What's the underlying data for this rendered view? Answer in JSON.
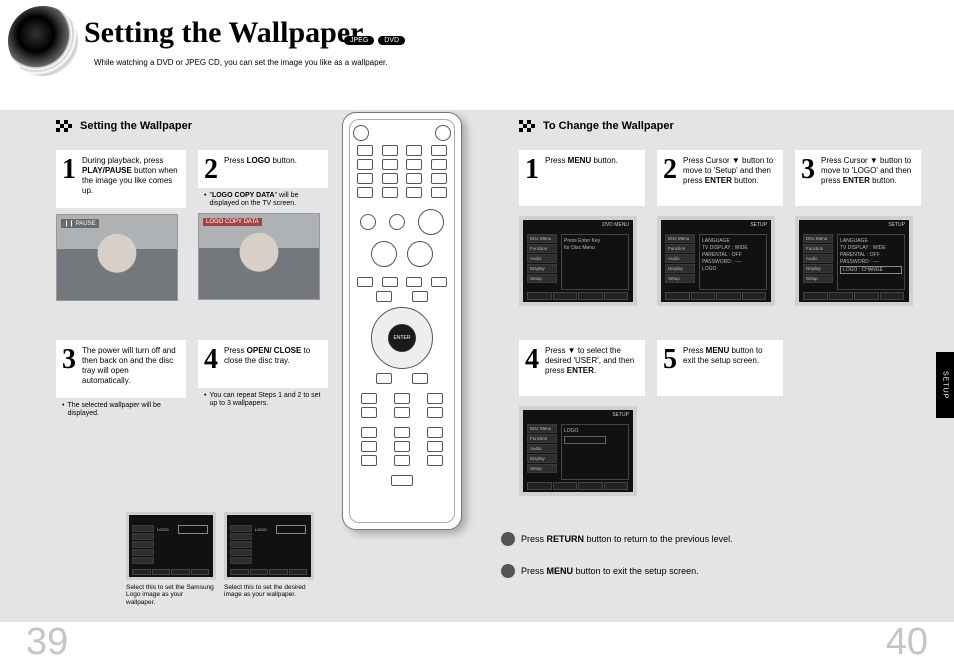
{
  "title": "Setting the Wallpaper",
  "badges": [
    "JPEG",
    "DVD"
  ],
  "subtitle": "While watching a DVD or JPEG CD, you can set the image you like as a wallpaper.",
  "left": {
    "section_heading": "Setting the Wallpaper",
    "step1": {
      "pre": "During playback, press ",
      "bold": "PLAY/PAUSE",
      "post": " button when the image you like comes up."
    },
    "photo1_tag": "❙❙ PAUSE",
    "step2": {
      "pre": "Press ",
      "bold": "LOGO",
      "post": " button."
    },
    "note2_pre": "\"",
    "note2_bold": "LOGO COPY DATA",
    "note2_post": "\" will be displayed on the TV screen.",
    "photo2_tag": "LOGO COPY DATA",
    "step3_text": "The power will turn off and then back on and the disc tray will open automatically.",
    "note3": "The selected wallpaper will be displayed.",
    "step4": {
      "pre": "Press ",
      "bold": "OPEN/ CLOSE",
      "post": " to close the disc tray."
    },
    "note4": "You can repeat Steps 1 and 2 to set up to 3 wallpapers.",
    "thumb1_label": "LOGO",
    "thumb1_caption": "Select this to set the Samsung Logo image as your wallpaper.",
    "thumb2_label": "LOGO",
    "thumb2_caption": "Select this to set the desired image as your wallpaper.",
    "page_num": "39"
  },
  "right": {
    "section_heading": "To Change the Wallpaper",
    "step1": {
      "pre": "Press ",
      "bold": "MENU",
      "post": " button."
    },
    "step2": {
      "pre": "Press Cursor ▼ button to move to 'Setup' and then press ",
      "bold": "ENTER",
      "post": " button."
    },
    "step3": {
      "pre": "Press Cursor ▼ button to move to 'LOGO' and then press ",
      "bold": "ENTER",
      "post": " button."
    },
    "step4": {
      "pre": "Press ▼ to select the desired 'USER', and then press ",
      "bold": "ENTER",
      "post": "."
    },
    "step5": {
      "pre": "Press ",
      "bold": "MENU",
      "post": " button to exit the setup screen."
    },
    "scr1_topbar": "DVD MENU",
    "scr1_main_l1": "Press Enter Key",
    "scr1_main_l2": "for Disc Menu",
    "scr2_topbar": "SETUP",
    "scr2_rows": [
      "LANGUAGE",
      "TV DISPLAY : WIDE",
      "PARENTAL : OFF",
      "PASSWORD : ----",
      "LOGO"
    ],
    "scr3_topbar": "SETUP",
    "scr3_rows": [
      "LANGUAGE",
      "TV DISPLAY : WIDE",
      "PARENTAL : OFF",
      "PASSWORD : ----",
      "LOGO : CHANGE"
    ],
    "scr4_topbar": "SETUP",
    "scr4_label": "LOGO",
    "side_items": [
      "Disc Menu",
      "Function",
      "Audio",
      "Display",
      "Setup"
    ],
    "return_line": {
      "pre": "Press ",
      "bold": "RETURN",
      "post": " button to return to the previous level."
    },
    "menu_line": {
      "pre": "Press ",
      "bold": "MENU",
      "post": " button to exit the setup screen."
    },
    "side_tab": "SETUP",
    "page_num": "40"
  },
  "remote": {
    "enter_label": "ENTER"
  }
}
